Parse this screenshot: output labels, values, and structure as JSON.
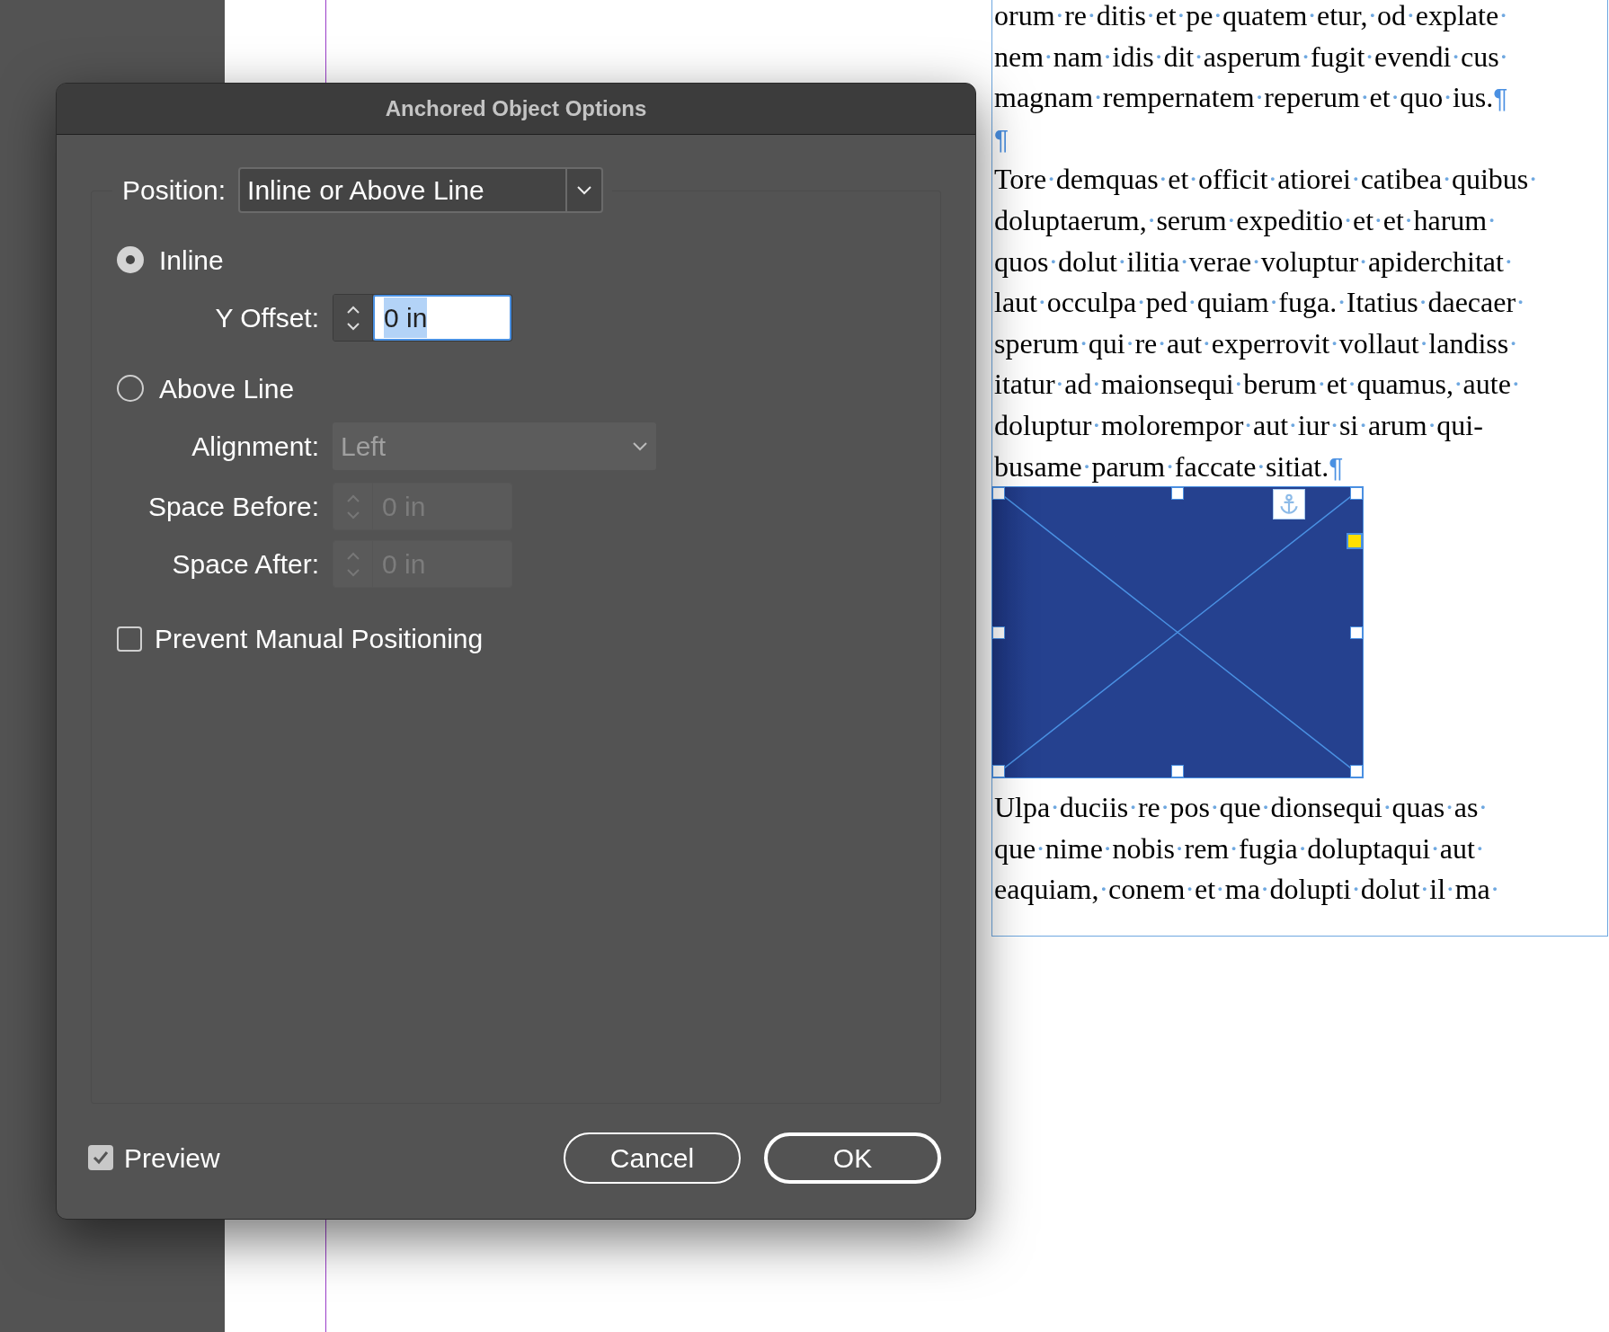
{
  "document": {
    "lines_before": [
      {
        "text": "orum·re·ditis·et·pe·quatem·etur,·od·explate·"
      },
      {
        "text": "nem·nam·idis·dit·asperum·fugit·evendi·cus·"
      },
      {
        "text": "magnam·rempernatem·reperum·et·quo·ius.",
        "mark": "¶"
      },
      {
        "mark": "¶"
      },
      {
        "text": "Tore·demquas·et·officit·atiorei·catibea·quibus·"
      },
      {
        "text": "doluptaerum,·serum·expeditio·et·et·harum·"
      },
      {
        "text": "quos·dolut·ilitia·verae·voluptur·apiderchitat·"
      },
      {
        "text": "laut·occulpa·ped·quiam·fuga.·Itatius·daecaer·"
      },
      {
        "text": "sperum·qui·re·aut·experrovit·vollaut·landiss·"
      },
      {
        "text": "itatur·ad·maionsequi·berum·et·quamus,·aute·"
      },
      {
        "text": "doluptur·molorempor·aut·iur·si·arum·qui-"
      },
      {
        "text": "busame·parum·faccate·sitiat.",
        "mark": "¶"
      }
    ],
    "anchored_frame": {
      "selected": true
    },
    "lines_after": [
      {
        "text": "Ulpa·duciis·re·pos·que·dionsequi·quas·as·"
      },
      {
        "text": "que·nime·nobis·rem·fugia·doluptaqui·aut·"
      },
      {
        "text": "eaquiam,·conem·et·ma·dolupti·dolut·il·ma·"
      }
    ]
  },
  "dialog": {
    "title": "Anchored Object Options",
    "position": {
      "label": "Position:",
      "value": "Inline or Above Line"
    },
    "options": [
      {
        "label": "Inline",
        "selected": true
      },
      {
        "label": "Above Line",
        "selected": false
      }
    ],
    "y_offset": {
      "label": "Y Offset:",
      "value": "0 in",
      "disabled": false,
      "highlighted": true
    },
    "alignment": {
      "label": "Alignment:",
      "value": "Left",
      "disabled": true
    },
    "space_before": {
      "label": "Space Before:",
      "value": "0 in",
      "disabled": true
    },
    "space_after": {
      "label": "Space After:",
      "value": "0 in",
      "disabled": true
    },
    "prevent_manual": {
      "label": "Prevent Manual Positioning",
      "checked": false
    },
    "preview": {
      "label": "Preview",
      "checked": true
    },
    "buttons": [
      {
        "label": "Cancel",
        "kind": "secondary"
      },
      {
        "label": "OK",
        "kind": "default"
      }
    ]
  }
}
